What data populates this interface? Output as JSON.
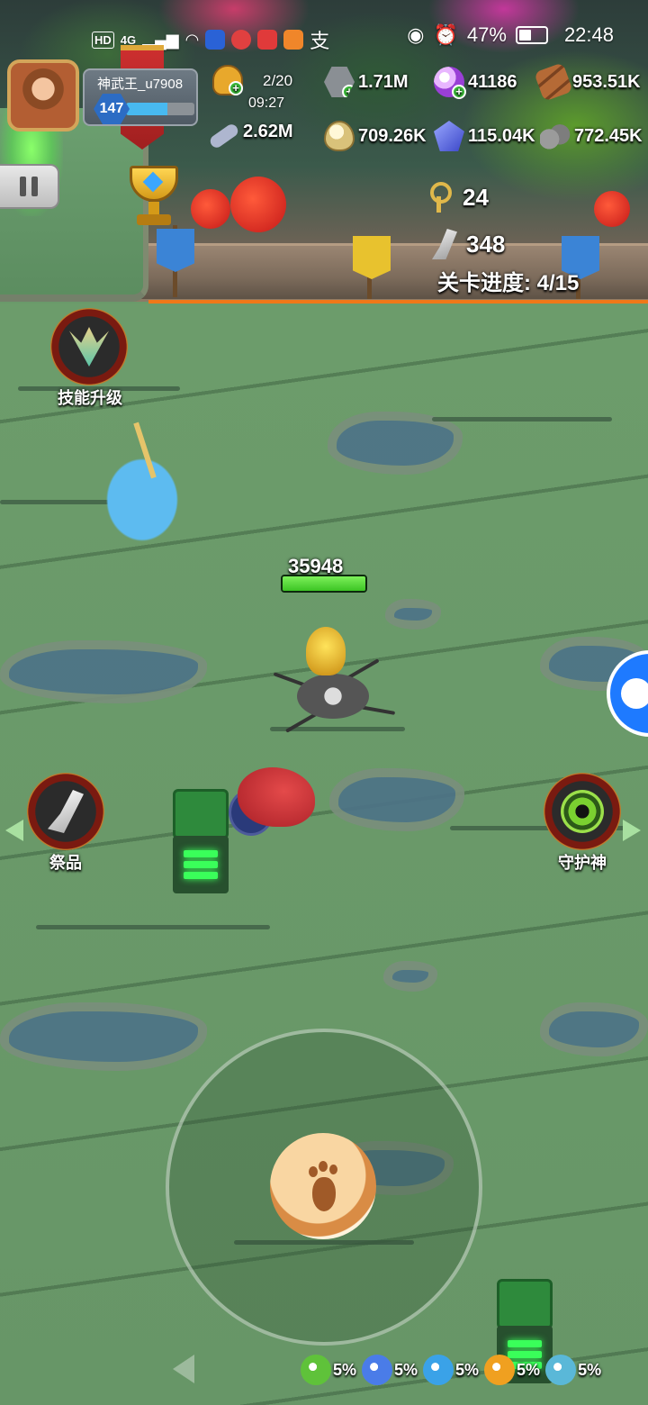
{
  "status_bar": {
    "left_badges": [
      "HD",
      "4G"
    ],
    "alipay_glyph": "支",
    "battery_percent": "47%",
    "time": "22:48"
  },
  "player": {
    "name": "神武王_u7908",
    "level": "147",
    "xp_fraction": 0.6
  },
  "resources": {
    "energy": {
      "count": "2/20",
      "timer": "09:27",
      "icon": "drumstick-icon"
    },
    "ore": {
      "value": "1.71M",
      "icon": "hex-nut-icon"
    },
    "orb": {
      "value": "41186",
      "icon": "purple-orb-icon"
    },
    "wood": {
      "value": "953.51K",
      "icon": "logs-icon"
    },
    "bone": {
      "value": "2.62M",
      "icon": "bone-icon"
    },
    "egg": {
      "value": "709.26K",
      "icon": "egg-icon"
    },
    "crystal": {
      "value": "115.04K",
      "icon": "crystal-icon"
    },
    "stone": {
      "value": "772.45K",
      "icon": "stone-icon"
    }
  },
  "stage": {
    "keys": "24",
    "claws": "348",
    "progress": "关卡进度: 4/15"
  },
  "buttons": {
    "skill_upgrade": "技能升级",
    "offering": "祭品",
    "guardian": "守护神"
  },
  "boss": {
    "hp": "35948",
    "hp_fraction": 1.0
  },
  "buffs": [
    {
      "icon": "green-swirl-icon",
      "value": "5%",
      "color": "#5fc23a"
    },
    {
      "icon": "blue-flame-icon",
      "value": "5%",
      "color": "#4a7ce8"
    },
    {
      "icon": "lightning-icon",
      "value": "5%",
      "color": "#3aa2e8"
    },
    {
      "icon": "sun-burst-icon",
      "value": "5%",
      "color": "#f0a020"
    },
    {
      "icon": "wind-icon",
      "value": "5%",
      "color": "#5ab8d8"
    }
  ],
  "colors": {
    "accent_line": "#f07818",
    "hp_green": "#3cc424",
    "controller_blue": "#1e7aff"
  }
}
